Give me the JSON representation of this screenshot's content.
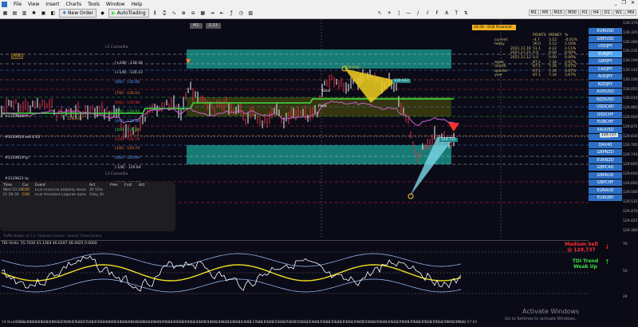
{
  "menu": [
    "File",
    "View",
    "Insert",
    "Charts",
    "Tools",
    "Window",
    "Help"
  ],
  "toolbar": {
    "new_order": "New Order",
    "autotrading": "AutoTrading"
  },
  "timeframes": [
    "M1",
    "M5",
    "M15",
    "M30",
    "H1",
    "H4",
    "D1",
    "W1",
    "MN"
  ],
  "top_tabs": [
    "M1",
    "2:23"
  ],
  "event_banner": "10:30 · ECB Financial Stabil",
  "stats": {
    "headers": [
      "",
      "",
      "POINTS",
      "MONEY",
      "%"
    ],
    "rows": [
      [
        "current",
        "",
        "-4.7",
        "3.12",
        "-0.01%"
      ],
      [
        "today",
        "",
        "36.0",
        "3.12",
        "1.16%"
      ],
      [
        "",
        "2021.11.16",
        "51.1",
        "4.22",
        "2.11%"
      ],
      [
        "",
        "2021.11.15",
        "0.0",
        "0.00",
        "0.00%"
      ],
      [
        "",
        "2021.11.12",
        "0.0",
        "0.00",
        "0.00%"
      ],
      [
        "week",
        "",
        "87.1",
        "7.34",
        "3.67%"
      ],
      [
        "month",
        "",
        "87.1",
        "7.34",
        "3.67%"
      ],
      [
        "quarter",
        "",
        "87.1",
        "7.34",
        "3.67%"
      ],
      [
        "year",
        "",
        "87.1",
        "7.34",
        "3.67%"
      ]
    ]
  },
  "symbols": [
    "EURUSD",
    "GBPUSD",
    "USDJPY",
    "EURJPY",
    "GBPJPY",
    "CADJPY",
    "AUDJPY",
    "NZDJPY",
    "AUDUSD",
    "NZDUSD",
    "USDCAD",
    "USDCHF",
    "EURCHF",
    "XAUUSD",
    "US30",
    "DAX40",
    "GBPNZD",
    "EURNZD",
    "GBPCAD",
    "GBPAUD",
    "GBPCHF",
    "EURAUD",
    "EURGBP"
  ],
  "active_symbol": "EURJPY",
  "price_scale": [
    "130.370",
    "130.325",
    "130.280",
    "130.235",
    "130.190",
    "130.145",
    "130.100",
    "130.055",
    "130.010",
    "129.965",
    "129.920",
    "129.875",
    "129.830",
    "129.785",
    "129.740",
    "129.695",
    "129.650",
    "129.605",
    "129.560",
    "129.515",
    "129.470",
    "129.425",
    "129.380",
    "76",
    "50",
    "24"
  ],
  "levels": [
    {
      "label": "L1 Camarilla",
      "value": "130.18",
      "color": "#888"
    },
    {
      "label": "[+2/8] - 130.18",
      "color": "#ddd"
    },
    {
      "label": "[+1/8] - 130.13",
      "color": "#ddd"
    },
    {
      "label": "[8/8] - 130.08",
      "color": "#4ea0ff"
    },
    {
      "label": "[7/8] - 130.03",
      "color": "#ff7a30"
    },
    {
      "label": "[6/8] - 129.98",
      "color": "#ff3030"
    },
    {
      "label": "[5/8] - 129.93",
      "color": "#3ee040"
    },
    {
      "label": "[4/8] - 129.88",
      "color": "#4ea0ff"
    },
    {
      "label": "[3/8] - 129.83",
      "color": "#3ee040"
    },
    {
      "label": "[2/8] - 129.78",
      "color": "#ff3030"
    },
    {
      "label": "[1/8] - 129.74",
      "color": "#ff7a30"
    },
    {
      "label": "[0/8] - 129.69",
      "color": "#4ea0ff"
    },
    {
      "label": "[-1/8] - 129.64",
      "color": "#ddd"
    },
    {
      "label": "L3 Camarilla",
      "color": "#888"
    },
    {
      "label": "[-2/8] - 129.59",
      "color": "#ddd"
    }
  ],
  "left_tags": [
    {
      "text": "ATR",
      "color": "#d0a040"
    },
    {
      "text": "#3129618.d",
      "color": "#ddd"
    },
    {
      "text": "#3129618 sell 0.02",
      "color": "#ddd"
    },
    {
      "text": "#3129619 tp",
      "color": "#ddd"
    },
    {
      "text": "#3129621 tp",
      "color": "#ddd"
    },
    {
      "text": "129.833",
      "color": "#d0a040"
    }
  ],
  "chart_tags": {
    "goal": "Goal",
    "pivot": "Pivot",
    "current_price": "129.737",
    "target_price": "130.023",
    "bottom_price": "129.658"
  },
  "news": {
    "headers": [
      "Time",
      "Cur",
      "Event",
      "Act",
      "Prev",
      "Fcst",
      "Act"
    ],
    "rows": [
      [
        "Wed 10:30",
        "EUR",
        "ECB Financial Stability Review",
        "2h 55m",
        "",
        "",
        ""
      ],
      [
        "Fri 09:30",
        "EUR",
        "ECB President Lagarde Speaks",
        "2day 2h",
        "",
        "",
        ""
      ]
    ]
  },
  "footer_credit": "Traffic Helper v1.7.1 · Fibonacci Levels · Source: Forex Factory",
  "indicator_title": "TDI Visits: 55.7030 41.1364 46.6197 48.4925 0.0000",
  "signal": {
    "sell_line1": "Medium Sell",
    "sell_line2": "@ 129.737",
    "trend_line1": "TDI Trend",
    "trend_line2": "Weak Up"
  },
  "time_axis": [
    "16 Nov 2021",
    "16 Nov 06:20",
    "16 Nov 06:35",
    "16 Nov 06:50",
    "16 Nov 07:05",
    "16 Nov 07:20",
    "16 Nov 07:35",
    "16 Nov 07:50",
    "16 Nov 08:05",
    "16 Nov 08:20",
    "16 Nov 08:35",
    "16 Nov 08:50",
    "16 Nov 09:05",
    "16 Nov 09:20",
    "16 Nov 09:35",
    "16 Nov 09:50",
    "16 Nov 10:05",
    "16 Nov 10:20",
    "16 Nov 10:35",
    "16 Nov 10:50",
    "16 Nov 11:05",
    "16 Nov 11:20",
    "17 Nov 02:05",
    "17 Nov 02:20",
    "17 Nov 02:35",
    "17 Nov 02:50",
    "17 Nov 03:05",
    "17 Nov 03:20",
    "17 Nov 03:35",
    "17 Nov 03:50",
    "17 Nov 04:05",
    "17 Nov 04:20",
    "17 Nov 04:35",
    "17 Nov 04:50",
    "17 Nov 05:05",
    "17 Nov 05:20",
    "17 Nov 05:35",
    "17 Nov 05:50",
    "17 Nov 06:05",
    "17 Nov 06:20",
    "17 Nov 07:05"
  ],
  "activate": {
    "title": "Activate Windows",
    "sub": "Go to Settings to activate Windows."
  },
  "colors": {
    "accent": "#2c6fc4",
    "sell": "#ff3030",
    "buy": "#3ee040",
    "zone": "#17a89a"
  }
}
